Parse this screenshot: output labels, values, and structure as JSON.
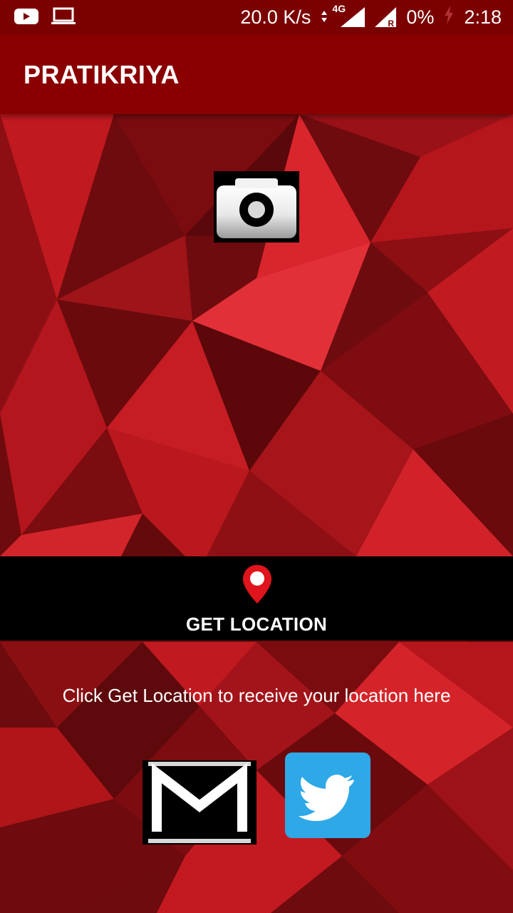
{
  "status_bar": {
    "speed": "20.0 K/s",
    "network": "4G",
    "roaming": "R",
    "battery": "0%",
    "time": "2:18"
  },
  "app_bar": {
    "title": "PRATIKRIYA"
  },
  "main": {
    "get_location_label": "GET LOCATION",
    "location_hint": "Click Get Location to receive your location here"
  },
  "icons": {
    "youtube": "youtube-icon",
    "laptop": "laptop-icon",
    "camera": "camera-icon",
    "pin": "location-pin-icon",
    "mail": "mail-icon",
    "twitter": "twitter-icon"
  },
  "colors": {
    "status_bar": "#7b0000",
    "app_bar": "#8a0000",
    "band": "#000000",
    "twitter_blue": "#2ea8e6",
    "pin_red": "#e0141c"
  }
}
